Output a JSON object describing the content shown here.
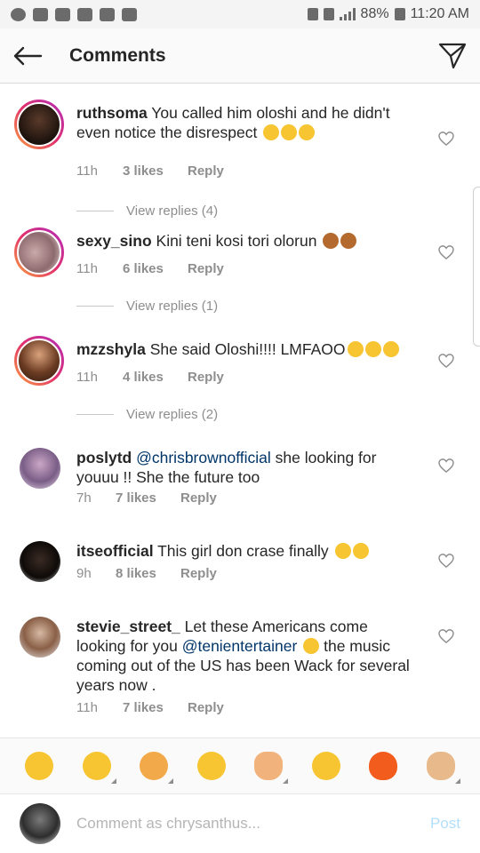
{
  "status_bar": {
    "battery": "88%",
    "time": "11:20 AM"
  },
  "header": {
    "title": "Comments",
    "back_icon": "arrow-left-icon",
    "send_icon": "paper-plane-icon"
  },
  "comments": [
    {
      "user": "ruthsoma",
      "text": "You called him oloshi and he didn't even notice the disrespect",
      "emojis": [
        "😆",
        "😆",
        "🤣"
      ],
      "time": "11h",
      "likes": "3 likes",
      "reply": "Reply",
      "view_replies": "View replies (4)",
      "story_ring": true
    },
    {
      "user": "sexy_sino",
      "text": "Kini teni kosi tori olorun",
      "emojis": [
        "🤦‍♀️",
        "🤦‍♀️"
      ],
      "time": "11h",
      "likes": "6 likes",
      "reply": "Reply",
      "view_replies": "View replies (1)",
      "story_ring": true
    },
    {
      "user": "mzzshyla",
      "text": "She said Oloshi!!!! LMFAOO",
      "emojis": [
        "🤣",
        "🤣",
        "🤣"
      ],
      "time": "11h",
      "likes": "4 likes",
      "reply": "Reply",
      "view_replies": "View replies (2)",
      "story_ring": true
    },
    {
      "user": "poslytd",
      "mention": "@chrisbrownofficial",
      "text": "  she looking for youuu !! She the future too",
      "time": "7h",
      "likes": "7 likes",
      "reply": "Reply",
      "story_ring": false
    },
    {
      "user": "itseofficial",
      "text": "This girl don crase finally",
      "emojis": [
        "😆",
        "😆"
      ],
      "time": "9h",
      "likes": "8 likes",
      "reply": "Reply",
      "story_ring": false
    },
    {
      "user": "stevie_street_",
      "text_before": "Let these Americans come looking for you",
      "mention": "@tenientertainer",
      "emojis": [
        "😲"
      ],
      "text_after": "the music coming out of the US has been Wack for several years now .",
      "time": "11h",
      "likes": "7 likes",
      "reply": "Reply",
      "story_ring": false
    }
  ],
  "emoji_bar": [
    "😂",
    "🤣",
    "😻",
    "😁",
    "✋",
    "🙂",
    "🔥",
    "👌"
  ],
  "input": {
    "placeholder": "Comment as chrysanthus...",
    "post_label": "Post"
  },
  "colors": {
    "accent": "#3897f0",
    "post_disabled": "#b2dffc",
    "mention": "#003569",
    "meta": "#8e8e8e"
  }
}
